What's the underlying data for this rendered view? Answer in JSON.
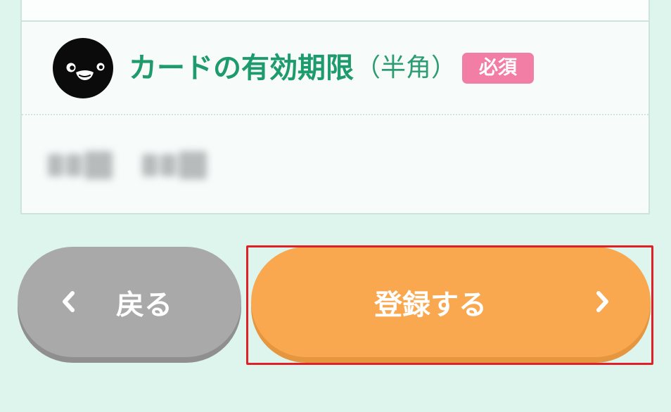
{
  "field": {
    "title": "カードの有効期限",
    "note": "（半角）",
    "required_badge": "必須"
  },
  "buttons": {
    "back_label": "戻る",
    "submit_label": "登録する"
  },
  "icons": {
    "avatar": "penguin-icon",
    "back": "chevron-left-icon",
    "submit": "chevron-right-icon"
  },
  "colors": {
    "background": "#def5ee",
    "title_green": "#1e9b6d",
    "required_pink": "#f27ea5",
    "submit_orange": "#f9a84f",
    "back_gray": "#a9a9a9",
    "highlight_red": "#e01f26"
  }
}
